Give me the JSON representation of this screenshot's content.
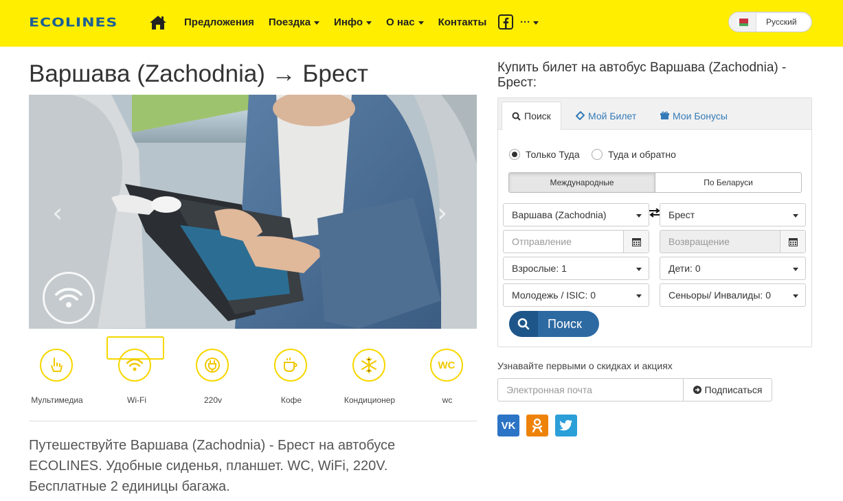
{
  "header": {
    "logo": "ECOLINES",
    "nav": [
      {
        "label": "Предложения",
        "dropdown": false
      },
      {
        "label": "Поездка",
        "dropdown": true
      },
      {
        "label": "Инфо",
        "dropdown": true
      },
      {
        "label": "О нас",
        "dropdown": true
      },
      {
        "label": "Контакты",
        "dropdown": false
      }
    ],
    "more_label": "···",
    "language": "Русский",
    "brand_color": "#ffee00"
  },
  "page": {
    "title": "Варшава (Zachodnia) → Брест",
    "carousel_prev": "‹",
    "carousel_next": "›",
    "amenities": [
      {
        "label": "Мультимедиа",
        "icon": "touch-icon"
      },
      {
        "label": "Wi-Fi",
        "icon": "wifi-icon",
        "selected": true
      },
      {
        "label": "220v",
        "icon": "plug-icon"
      },
      {
        "label": "Кофе",
        "icon": "coffee-icon"
      },
      {
        "label": "Кондиционер",
        "icon": "snowflake-icon"
      },
      {
        "label": "wc",
        "icon": "wc-icon",
        "text": "WC"
      }
    ],
    "description": "Путешествуйте Варшава (Zachodnia) - Брест на автобусе ECOLINES. Удобные сиденья, планшет. WC, WiFi, 220V. Бесплатные 2 единицы багажа."
  },
  "booking": {
    "heading": "Купить билет на автобус Варшава (Zachodnia) - Брест:",
    "tabs": [
      {
        "label": "Поиск",
        "active": true
      },
      {
        "label": "Мой Билет",
        "active": false
      },
      {
        "label": "Мои Бонусы",
        "active": false
      }
    ],
    "trip_type": {
      "one_way": "Только Туда",
      "round_trip": "Туда и обратно",
      "selected": "one_way"
    },
    "route_type": {
      "international": "Международные",
      "domestic": "По Беларуси",
      "selected": "international"
    },
    "from": "Варшава (Zachodnia)",
    "to": "Брест",
    "departure_placeholder": "Отправление",
    "return_placeholder": "Возвращение",
    "adults": "Взрослые: 1",
    "children": "Дети: 0",
    "youth": "Молодежь / ISIC: 0",
    "seniors": "Сеньоры/ Инвалиды: 0",
    "search_button": "Поиск"
  },
  "newsletter": {
    "label": "Узнавайте первыми о скидках и акциях",
    "email_placeholder": "Электронная почта",
    "subscribe_button": "Подписаться"
  },
  "social": [
    {
      "name": "vk-icon",
      "text": "VK",
      "color": "#2c74c5"
    },
    {
      "name": "odnoklassniki-icon",
      "text": "ОК",
      "color": "#ee8208"
    },
    {
      "name": "twitter-icon",
      "text": "",
      "color": "#2a9fd8"
    }
  ]
}
